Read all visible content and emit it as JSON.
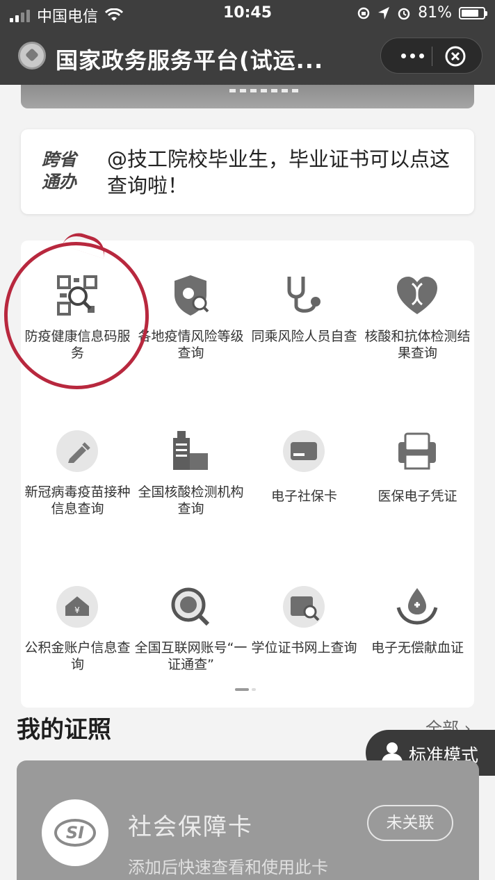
{
  "status_bar": {
    "carrier": "中国电信",
    "time": "10:45",
    "battery_level": "81%",
    "battery_fraction": 0.81
  },
  "title_bar": {
    "title": "国家政务服务平台(试运..."
  },
  "notice": {
    "tag": "跨省通办",
    "text": "@技工院校毕业生，毕业证书可以点这查询啦！"
  },
  "services": [
    {
      "label": "防疫健康信息码服务",
      "icon": "qr-scan-icon"
    },
    {
      "label": "各地疫情风险等级查询",
      "icon": "virus-shield-icon"
    },
    {
      "label": "同乘风险人员自查",
      "icon": "stethoscope-icon"
    },
    {
      "label": "核酸和抗体检测结果查询",
      "icon": "dna-heart-icon"
    },
    {
      "label": "新冠病毒疫苗接种信息查询",
      "icon": "vaccine-icon"
    },
    {
      "label": "全国核酸检测机构查询",
      "icon": "hospital-icon"
    },
    {
      "label": "电子社保卡",
      "icon": "social-card-icon"
    },
    {
      "label": "医保电子凭证",
      "icon": "medical-insurance-icon"
    },
    {
      "label": "公积金账户信息查询",
      "icon": "housing-fund-icon"
    },
    {
      "label": "全国互联网账号“一证通查”",
      "icon": "account-search-icon"
    },
    {
      "label": "学位证书网上查询",
      "icon": "certificate-search-icon"
    },
    {
      "label": "电子无偿献血证",
      "icon": "blood-donation-icon"
    }
  ],
  "my_certs": {
    "title": "我的证照",
    "all_label": "全部"
  },
  "mode_button": {
    "label": "标准模式"
  },
  "card": {
    "name": "社会保障卡",
    "hint": "添加后快速查看和使用此卡",
    "status": "未关联",
    "logo_text": "SI"
  }
}
